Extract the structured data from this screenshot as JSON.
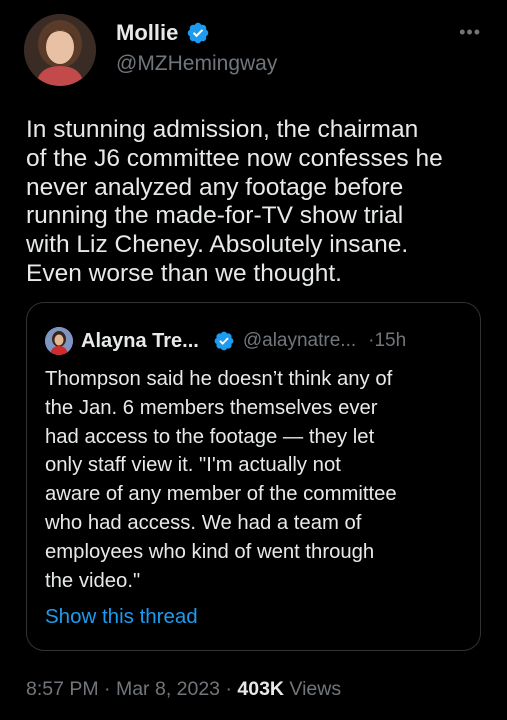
{
  "author": {
    "name": "Mollie",
    "handle": "@MZHemingway",
    "verified": true,
    "avatar": "avatar-photo"
  },
  "more_icon": "more-horizontal-icon",
  "body_lines": [
    "In stunning admission, the chairman",
    "of the J6 committee now confesses he",
    "never analyzed any footage before",
    "running the made-for-TV show trial",
    "with Liz Cheney. Absolutely insane.",
    "Even worse than we thought."
  ],
  "quote": {
    "name": "Alayna Tre...",
    "handle": "@alaynatre...",
    "separator": "·",
    "time": "15h",
    "verified": true,
    "lines": [
      "Thompson said he doesn’t think any of",
      "the Jan. 6 members themselves ever",
      "had access to the footage — they let",
      "only staff view it. \"I'm actually not",
      "aware of any member of the committee",
      "who had access. We had a team of",
      "employees who kind of went through",
      "the video.\""
    ],
    "show_thread": "Show this thread"
  },
  "meta": {
    "time": "8:57 PM",
    "sep1": " · ",
    "date": "Mar 8, 2023",
    "sep2": " · ",
    "views_count": "403K",
    "views_label": " Views"
  },
  "colors": {
    "background": "#000000",
    "text": "#e7e9ea",
    "secondary": "#71767b",
    "link": "#1d9bf0",
    "verified": "#1d9bf0",
    "border": "#2f3336"
  }
}
